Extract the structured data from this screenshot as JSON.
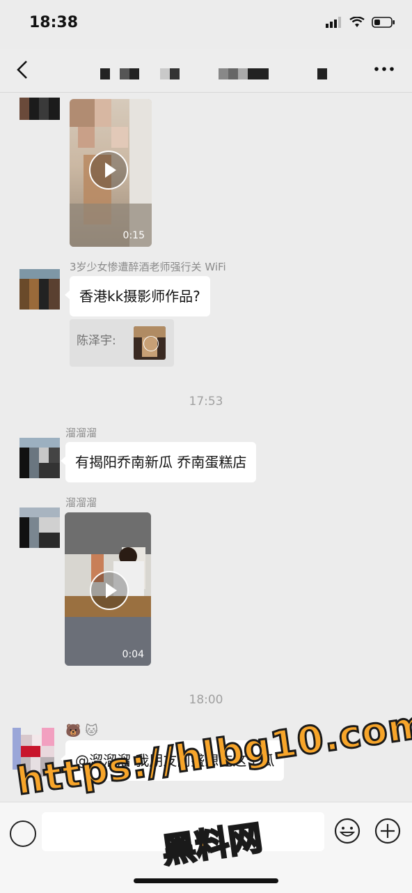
{
  "status_bar": {
    "time": "18:38"
  },
  "messages": {
    "video1": {
      "duration": "0:15"
    },
    "caption_partial": "3岁少女惨遭醉酒老师强行关 WiFi",
    "text1": "香港kk摄影师作品?",
    "quote1": {
      "text": "陈泽宇:"
    },
    "time_sep1": "17:53",
    "sender2": "溜溜溜",
    "text2": "有揭阳乔南新瓜  乔南蛋糕店",
    "sender3": "溜溜溜",
    "video2": {
      "duration": "0:04"
    },
    "time_sep2": "18:00",
    "sender4": "🐻 🐱",
    "text4": "@溜溜溜 我朋友阿盛想吃这个瓜"
  },
  "watermark": {
    "url": "https://hlbg10.com",
    "site": "黑料网"
  },
  "colors": {
    "background": "#ececec",
    "bubble": "#ffffff",
    "watermark": "#f7a52a"
  },
  "icons": [
    "back-arrow-icon",
    "more-icon",
    "voice-icon",
    "emoji-icon",
    "plus-icon",
    "play-icon"
  ]
}
